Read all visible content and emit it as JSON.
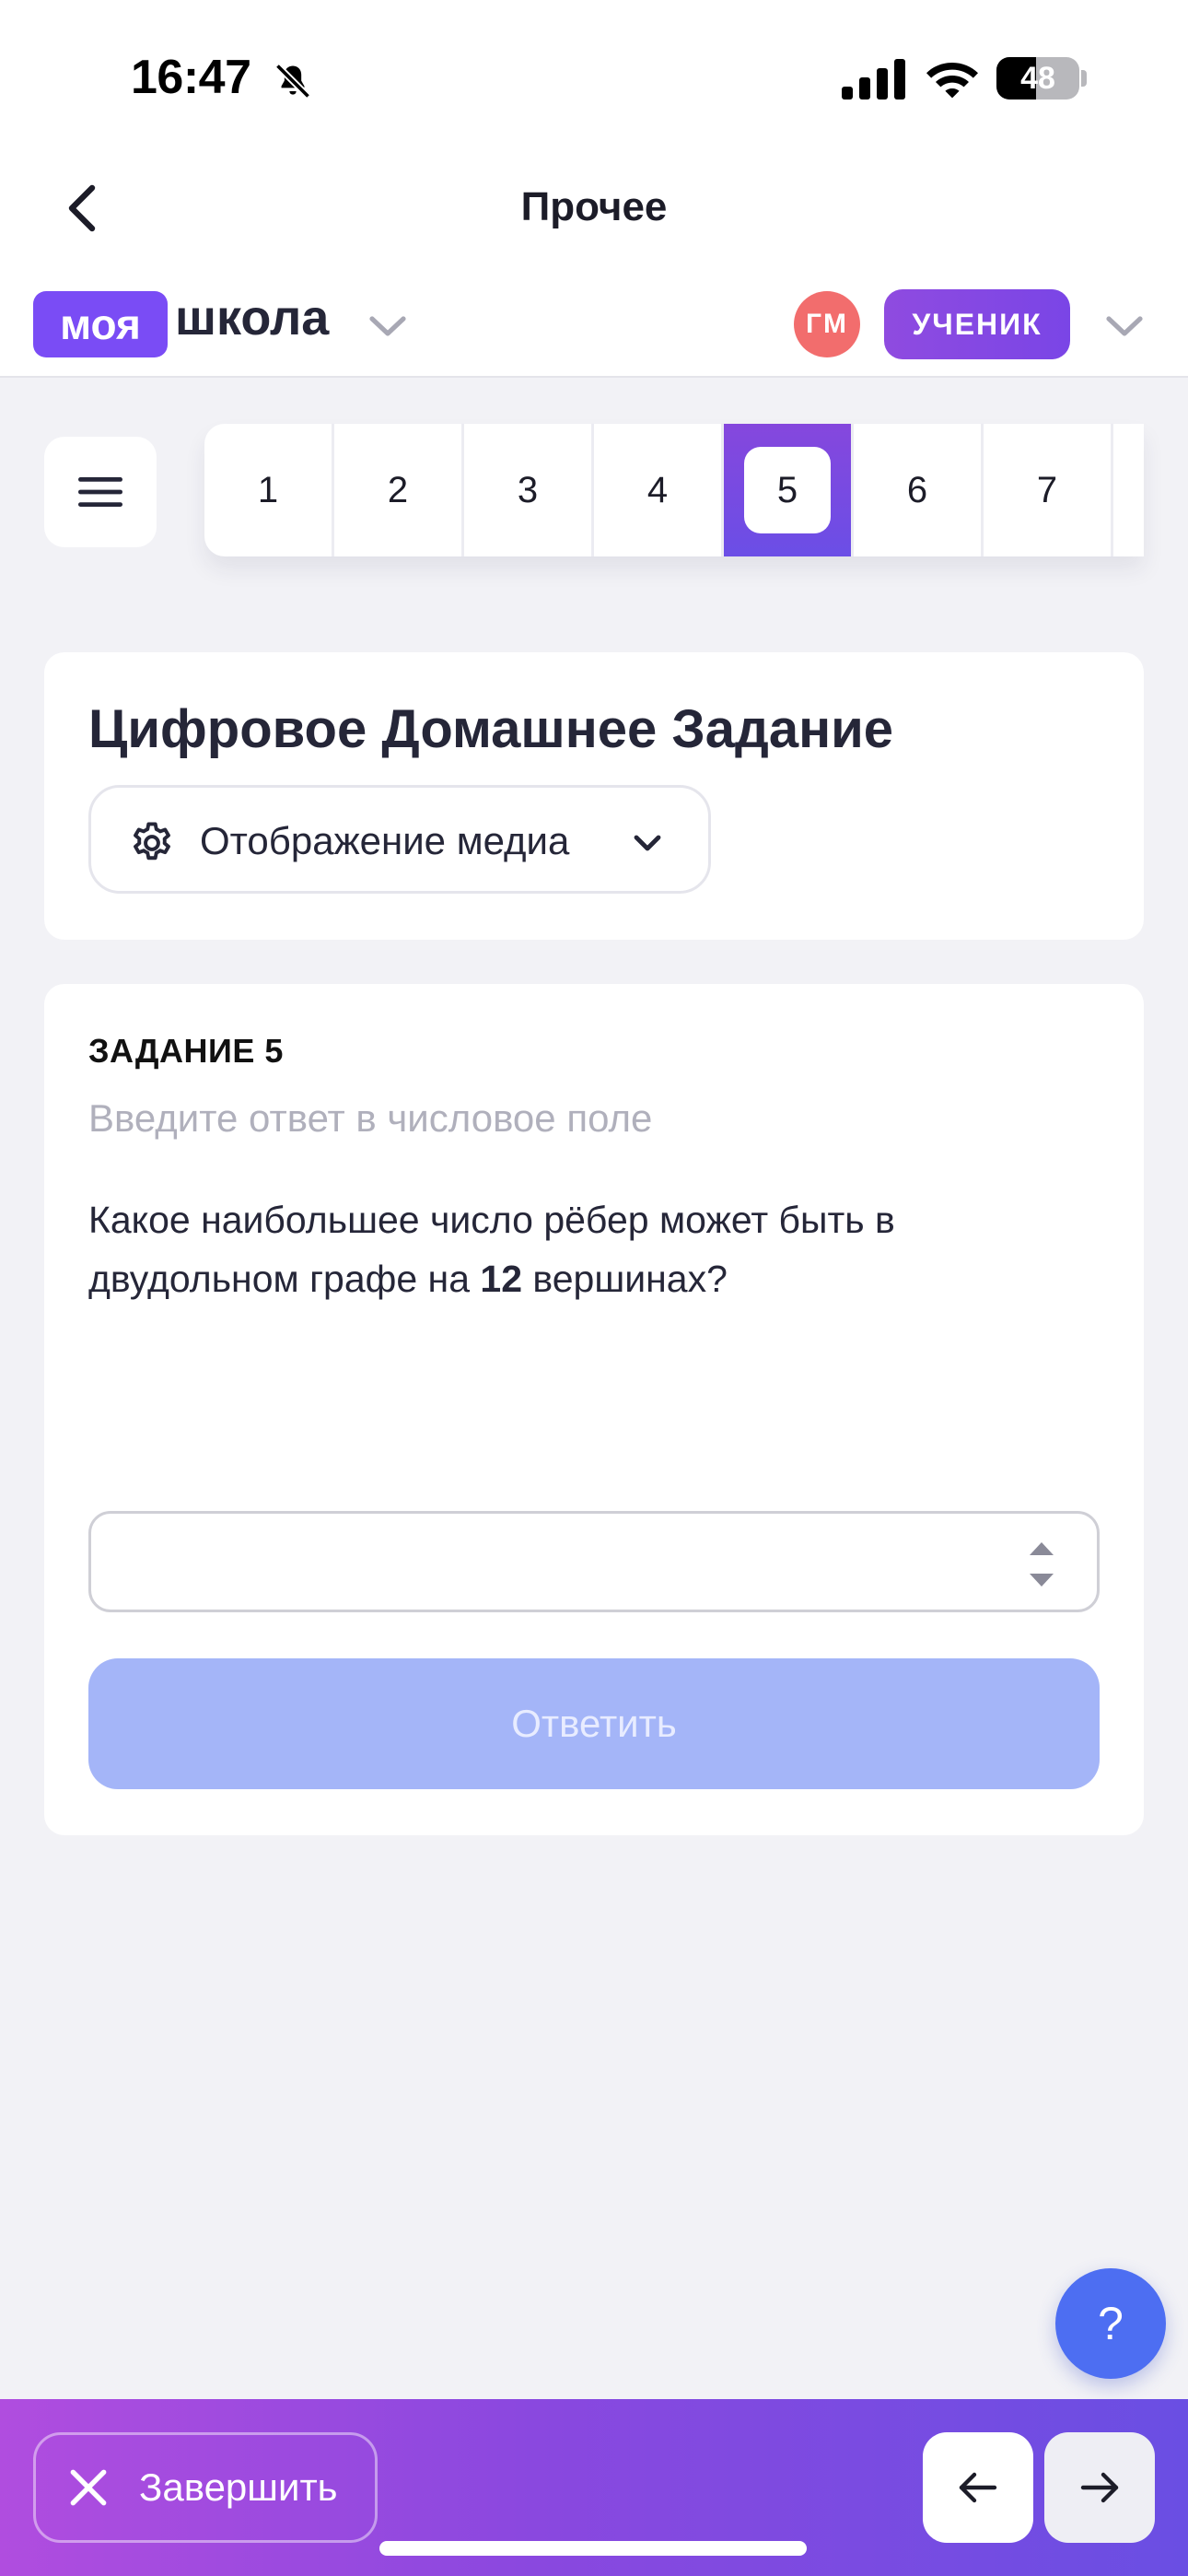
{
  "status_bar": {
    "time": "16:47",
    "battery": "48",
    "battery_level": 0.48,
    "icons": [
      "bell-slash-icon",
      "signal-icon",
      "wifi-icon",
      "battery-icon"
    ]
  },
  "header": {
    "title": "Прочее",
    "back_icon": "chevron-left-icon"
  },
  "brand": {
    "chip": "моя",
    "word": "школа"
  },
  "user": {
    "initials": "ГМ",
    "role": "УЧЕНИК"
  },
  "question_nav": {
    "items": [
      "1",
      "2",
      "3",
      "4",
      "5",
      "6",
      "7"
    ],
    "active": "5"
  },
  "homework": {
    "title": "Цифровое Домашнее Задание",
    "media_label": "Отображение медиа"
  },
  "task": {
    "label": "ЗАДАНИЕ 5",
    "hint": "Введите ответ в числовое поле",
    "question_before": "Какое наибольшее число рёбер может быть в двудольном графе на ",
    "question_bold": "12",
    "question_after": " вершинах?",
    "answer_value": "",
    "submit_label": "Ответить"
  },
  "help": {
    "label": "?"
  },
  "bottom_bar": {
    "finish_label": "Завершить"
  },
  "colors": {
    "brand_purple": "#7a4cf5",
    "avatar_red": "#f26d6d",
    "submit_disabled": "#a4b5f8",
    "help_blue": "#4d6ef2",
    "background": "#f2f2f6"
  }
}
